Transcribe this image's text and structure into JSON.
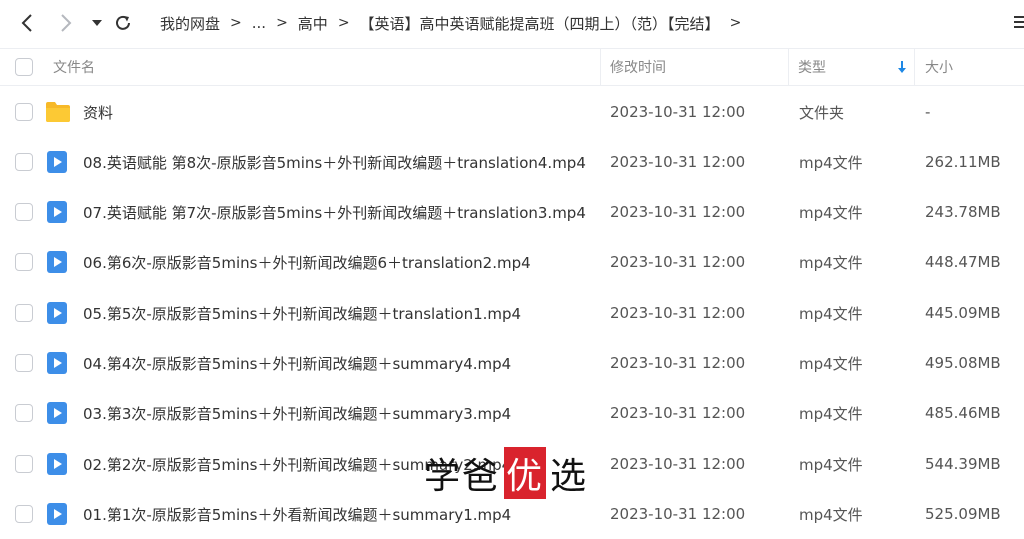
{
  "breadcrumb": {
    "items": [
      "我的网盘",
      "...",
      "高中",
      "【英语】高中英语赋能提高班（四期上）（范）【完结】"
    ],
    "separator": ">"
  },
  "columns": {
    "name": "文件名",
    "modified": "修改时间",
    "type": "类型",
    "size": "大小"
  },
  "files": [
    {
      "name": "资料",
      "modified": "2023-10-31 12:00",
      "type": "文件夹",
      "size": "-",
      "icon": "folder-icon"
    },
    {
      "name": "08.英语赋能 第8次-原版影音5mins＋外刊新闻改编题＋translation4.mp4",
      "modified": "2023-10-31 12:00",
      "type": "mp4文件",
      "size": "262.11MB",
      "icon": "video-icon"
    },
    {
      "name": "07.英语赋能 第7次-原版影音5mins＋外刊新闻改编题＋translation3.mp4",
      "modified": "2023-10-31 12:00",
      "type": "mp4文件",
      "size": "243.78MB",
      "icon": "video-icon"
    },
    {
      "name": "06.第6次-原版影音5mins＋外刊新闻改编题6＋translation2.mp4",
      "modified": "2023-10-31 12:00",
      "type": "mp4文件",
      "size": "448.47MB",
      "icon": "video-icon"
    },
    {
      "name": "05.第5次-原版影音5mins＋外刊新闻改编题＋translation1.mp4",
      "modified": "2023-10-31 12:00",
      "type": "mp4文件",
      "size": "445.09MB",
      "icon": "video-icon"
    },
    {
      "name": "04.第4次-原版影音5mins＋外刊新闻改编题＋summary4.mp4",
      "modified": "2023-10-31 12:00",
      "type": "mp4文件",
      "size": "495.08MB",
      "icon": "video-icon"
    },
    {
      "name": "03.第3次-原版影音5mins＋外刊新闻改编题＋summary3.mp4",
      "modified": "2023-10-31 12:00",
      "type": "mp4文件",
      "size": "485.46MB",
      "icon": "video-icon"
    },
    {
      "name": "02.第2次-原版影音5mins＋外刊新闻改编题＋summary2.mp4",
      "modified": "2023-10-31 12:00",
      "type": "mp4文件",
      "size": "544.39MB",
      "icon": "video-icon"
    },
    {
      "name": "01.第1次-原版影音5mins＋外看新闻改编题＋summary1.mp4",
      "modified": "2023-10-31 12:00",
      "type": "mp4文件",
      "size": "525.09MB",
      "icon": "video-icon"
    }
  ],
  "watermark": {
    "part1": "学爸",
    "part2": "优",
    "part3": "选"
  },
  "colors": {
    "accent": "#1e88e5",
    "folder": "#f7b928",
    "video": "#3d8ee8",
    "watermark_red": "#d9232d"
  }
}
